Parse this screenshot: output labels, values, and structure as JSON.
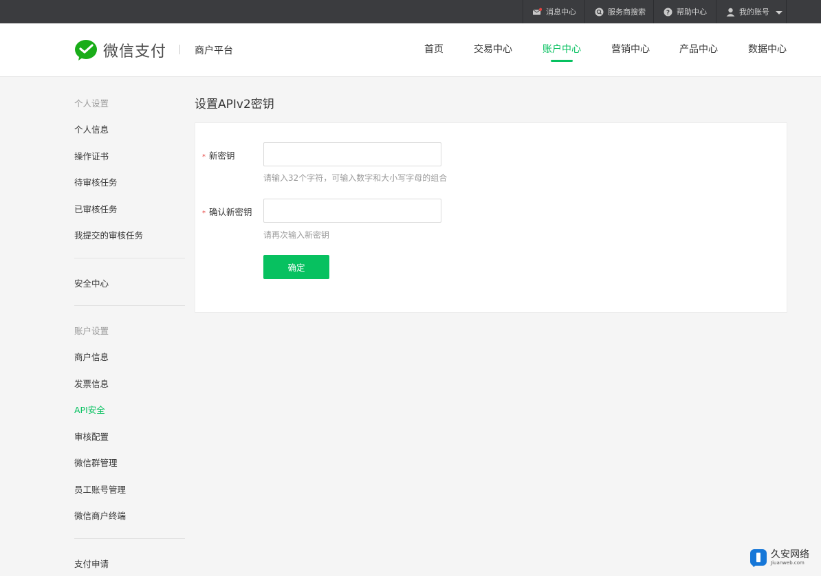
{
  "topbar": {
    "messages": "消息中心",
    "provider_search": "服务商搜索",
    "help": "帮助中心",
    "account": "我的账号"
  },
  "header": {
    "logo_text": "微信支付",
    "platform": "商户平台",
    "nav": [
      "首页",
      "交易中心",
      "账户中心",
      "营销中心",
      "产品中心",
      "数据中心"
    ],
    "active_nav": "账户中心"
  },
  "sidebar": {
    "personal_heading": "个人设置",
    "personal_items": [
      "个人信息",
      "操作证书",
      "待审核任务",
      "已审核任务",
      "我提交的审核任务"
    ],
    "security_center": "安全中心",
    "account_heading": "账户设置",
    "account_items": [
      "商户信息",
      "发票信息",
      "API安全",
      "审核配置",
      "微信群管理",
      "员工账号管理",
      "微信商户终端"
    ],
    "active_item": "API安全",
    "payment_apply": "支付申请"
  },
  "main": {
    "title": "设置APIv2密钥",
    "required_mark": "*",
    "new_key_label": "新密钥",
    "new_key_value": "",
    "new_key_hint": "请输入32个字符，可输入数字和大小写字母的组合",
    "confirm_key_label": "确认新密钥",
    "confirm_key_value": "",
    "confirm_key_hint": "请再次输入新密钥",
    "submit": "确定"
  },
  "watermark": {
    "main": "久安网络",
    "sub": "Jiuanweb.com"
  },
  "colors": {
    "accent": "#07c160",
    "topbar": "#3b3c3f",
    "required": "#e64340"
  }
}
